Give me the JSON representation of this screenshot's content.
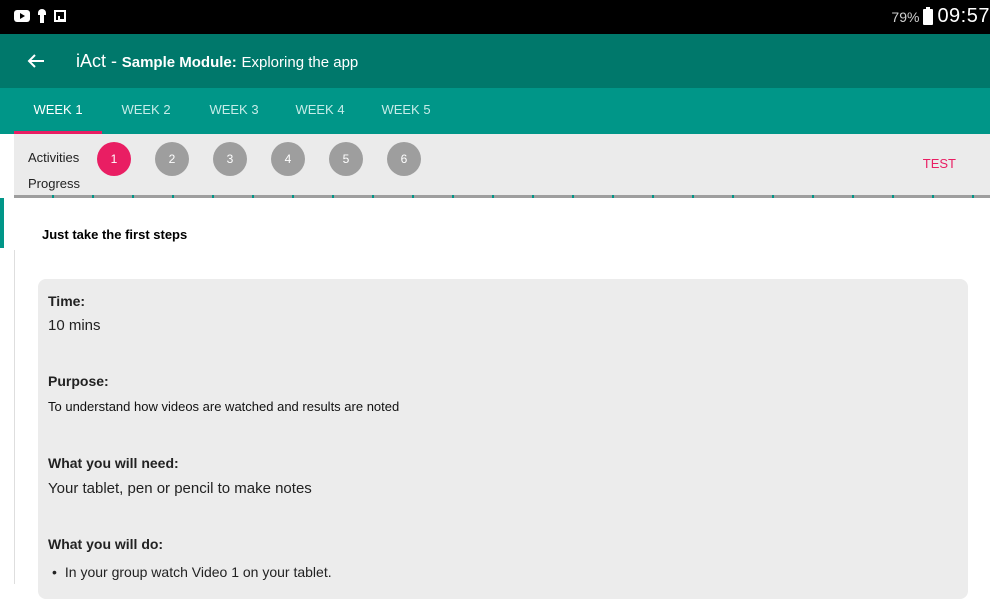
{
  "status_bar": {
    "icons": [
      "youtube-icon",
      "key-icon",
      "image-icon"
    ],
    "battery": "79%",
    "time": "09:57"
  },
  "app_bar": {
    "app_name": "iAct -",
    "module_label": "Sample Module:",
    "module_subtitle": "Exploring the app"
  },
  "tabs": [
    {
      "label": "WEEK 1",
      "active": true
    },
    {
      "label": "WEEK 2",
      "active": false
    },
    {
      "label": "WEEK 3",
      "active": false
    },
    {
      "label": "WEEK 4",
      "active": false
    },
    {
      "label": "WEEK 5",
      "active": false
    }
  ],
  "activities": {
    "activities_label": "Activities",
    "progress_label": "Progress",
    "items": [
      "1",
      "2",
      "3",
      "4",
      "5",
      "6"
    ],
    "active_index": 0,
    "test_label": "TEST"
  },
  "content": {
    "heading": "Just take the first steps",
    "time_title": "Time:",
    "time_value": "10 mins",
    "purpose_title": "Purpose:",
    "purpose_value": "To understand how videos are watched and results are noted",
    "need_title": "What you will need:",
    "need_value": "Your tablet, pen or pencil to make notes",
    "do_title": "What you will do:",
    "do_items": [
      "In your group watch Video 1 on your tablet."
    ]
  },
  "colors": {
    "app_bar": "#00786b",
    "tab_bar": "#009688",
    "accent": "#e91e63",
    "inactive_circle": "#9e9e9e"
  }
}
